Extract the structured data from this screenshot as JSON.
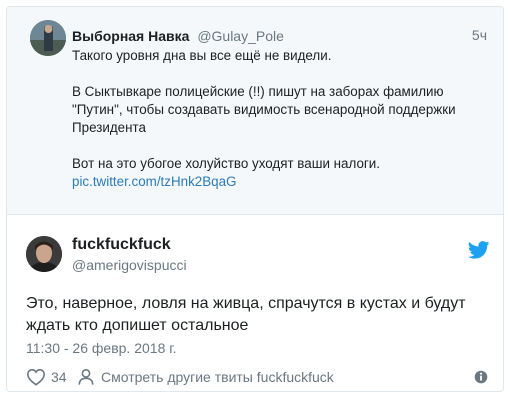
{
  "quoted_tweet": {
    "author_name": "Выборная Навка",
    "author_handle": "@Gulay_Pole",
    "time": "5ч",
    "paragraphs": [
      "Такого уровня дна вы все ещё не видели.",
      "В Сыктывкаре полицейские (!!) пишут на заборах фамилию \"Путин\", чтобы создавать видимость всенародной поддержки Президента",
      "Вот на это убогое холуйство уходят ваши налоги."
    ],
    "link": "pic.twitter.com/tzHnk2BqaG"
  },
  "tweet": {
    "author_name": "fuckfuckfuck",
    "author_handle": "@amerigovispucci",
    "text_lines": [
      "Это, наверное, ловля на живца, спрачутся в кустах и будут",
      "ждать кто допишет остальное"
    ],
    "date": "11:30 - 26 февр. 2018 г.",
    "like_count": "34",
    "more_tweets_label": "Смотреть другие твиты fuckfuckfuck"
  },
  "icons": {
    "twitter_bird": "twitter-bird-icon",
    "heart": "heart-icon",
    "person": "person-icon",
    "info": "info-icon"
  },
  "colors": {
    "twitter_blue": "#1da1f2",
    "link_blue": "#2b7bb9",
    "muted_gray": "#697882",
    "quoted_background": "#f5f8fa"
  }
}
